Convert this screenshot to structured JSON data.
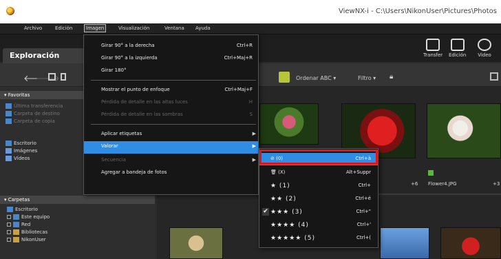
{
  "window": {
    "title": "ViewNX-i - C:\\Users\\NikonUser\\Pictures\\Photos"
  },
  "menubar": [
    "Archivo",
    "Edición",
    "Imagen",
    "Visualización",
    "Ventana",
    "Ayuda"
  ],
  "module": {
    "explorer_tab": "Exploración"
  },
  "tools": {
    "transfer": "Transfer",
    "edicion": "Edición",
    "video": "Video"
  },
  "toolbar": {
    "ordenar": "Ordenar ABC ▾",
    "filtro": "Filtro ▾"
  },
  "favorites": {
    "header": "Favoritas",
    "items": [
      "Última transferencia",
      "Carpeta de destino",
      "Carpeta de copia"
    ],
    "shortcuts": [
      "Escritorio",
      "Imágenes",
      "Vídeos"
    ]
  },
  "folders": {
    "header": "Carpetas",
    "items": [
      "Escritorio",
      "Este equipo",
      "Red",
      "Bibliotecas",
      "NikonUser"
    ]
  },
  "content": {
    "file_label": "Flower4.JPG",
    "row_marker_1": "+6",
    "row_marker_2": "+3"
  },
  "image_menu": {
    "items": [
      {
        "label": "Girar 90° a la derecha",
        "shortcut": "Ctrl+R"
      },
      {
        "label": "Girar 90° a la izquierda",
        "shortcut": "Ctrl+Maj+R"
      },
      {
        "label": "Girar 180°",
        "shortcut": ""
      },
      {
        "label": "Mostrar el punto de enfoque",
        "shortcut": "Ctrl+Maj+F"
      },
      {
        "label": "Pérdida de detalle en las altas luces",
        "shortcut": "H"
      },
      {
        "label": "Pérdida de detalle en las sombras",
        "shortcut": "S"
      },
      {
        "label": "Aplicar etiquetas",
        "shortcut": ""
      },
      {
        "label": "Valorar",
        "shortcut": ""
      },
      {
        "label": "Secuencia",
        "shortcut": ""
      },
      {
        "label": "Agregar a bandeja de fotos",
        "shortcut": ""
      }
    ]
  },
  "rating_menu": {
    "items": [
      {
        "label": "⊘ (0)",
        "shortcut": "Ctrl+à"
      },
      {
        "label": "🗑 (X)",
        "shortcut": "Alt+Suppr"
      },
      {
        "label": "★ (1)",
        "shortcut": "Ctrl+"
      },
      {
        "label": "★★ (2)",
        "shortcut": "Ctrl+é"
      },
      {
        "label": "★★★ (3)",
        "shortcut": "Ctrl+\""
      },
      {
        "label": "★★★★ (4)",
        "shortcut": "Ctrl+'"
      },
      {
        "label": "★★★★★ (5)",
        "shortcut": "Ctrl+("
      }
    ],
    "checked_index": 4
  },
  "colors": {
    "highlight": "#2f8de4",
    "callout": "#e0151b",
    "tag_button": "#b7c53b"
  }
}
